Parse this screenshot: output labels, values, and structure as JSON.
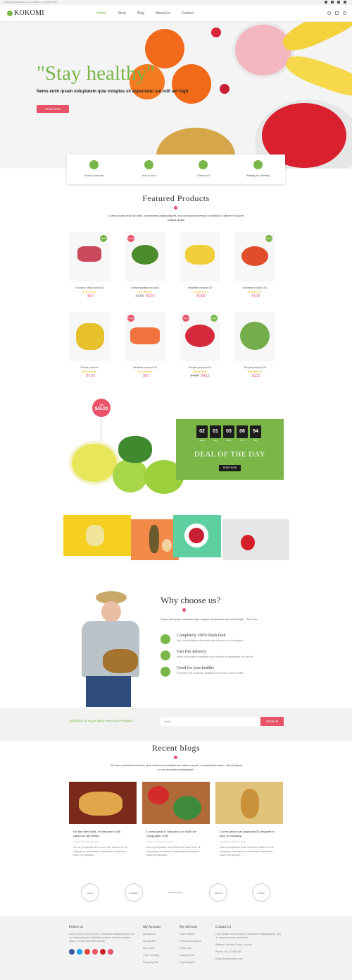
{
  "topbar": {
    "info": "Email: support@kokomi.com  |  Hotline: (+1) 234 567 890"
  },
  "header": {
    "logo": "KOKOMI",
    "nav": [
      "Home",
      "Shop",
      "Blog",
      "About Us",
      "Contact"
    ]
  },
  "hero": {
    "title": "\"Stay healthy\"",
    "subtitle": "Nemo enim ipsam voluptatem quia voluptas sit aspernatur aut odit aut fugit",
    "button": "SHOP NOW"
  },
  "steps": [
    "Select products",
    "Add to cart",
    "Check out",
    "Waiting for delivery"
  ],
  "featured": {
    "title": "Featured Products",
    "desc": "Lorem ipsum dolor sit amet, consectetur adipiscing elit, sed do eiusmod tempor incididunt ut labore et dolore magna aliqua",
    "products": [
      {
        "name": "Excuitur sllitur product",
        "stars": "★★★★★",
        "old": "",
        "price": "$60"
      },
      {
        "name": "Downloadable product",
        "stars": "★★★★★",
        "old": "$150",
        "price": "$120"
      },
      {
        "name": "Variable product 02",
        "stars": "★★★★★",
        "old": "",
        "price": "$150"
      },
      {
        "name": "Variable product 04",
        "stars": "★★★★★",
        "old": "",
        "price": "$130"
      },
      {
        "name": "Virtual product",
        "stars": "★★★★★",
        "old": "",
        "price": "$150"
      },
      {
        "name": "Variable product 01",
        "stars": "★★★★★",
        "old": "",
        "price": "$65"
      },
      {
        "name": "Simple product 02",
        "stars": "★★★★★",
        "old": "$455",
        "price": "$422"
      },
      {
        "name": "Simple product 03",
        "stars": "★★★★★",
        "old": "",
        "price": "$232"
      }
    ]
  },
  "deal": {
    "badge_only": "only",
    "badge_price": "$45.00",
    "digits": [
      "02",
      "01",
      "03",
      "06",
      "54"
    ],
    "digit_labels": [
      "Weeks",
      "Days",
      "Hours",
      "Mins",
      "Secs"
    ],
    "title": "DEAL OF THE DAY",
    "button": "SHOP NOW"
  },
  "why": {
    "title": "Why choose us?",
    "quote": "\"Nemo enim ipsam voluptatem quia voluptas sit aspernatur aut odit aut fugit.\" - John Doe",
    "items": [
      {
        "title": "Completely 100% fresh food",
        "desc": "Sed ut perspiciatis unde omnis iste natus error sit voluptatem"
      },
      {
        "title": "Fast free delivery",
        "desc": "Nemo enim ipsam voluptatem quia voluptas sit aspernatur aut odit aut"
      },
      {
        "title": "Good for your healthy",
        "desc": "Excepteur sint occaecat cupidatat non proident, sunt in culpa"
      }
    ]
  },
  "newsletter": {
    "text": "Subscribe us to get latest News and Products",
    "placeholder": "Email",
    "button": "SIGN IN"
  },
  "blogs": {
    "title": "Recent blogs",
    "desc": "\"Ut enim ad minima veniam, quis nostrum exercitationem ullam corporis suscipit laboriosam, nisi ut aliquid ex ea commodi consequatur\"",
    "posts": [
      {
        "title": "On the other hand, we denounce with righteous and dislike",
        "meta": "January 25, 2018 / by admin",
        "desc": "Sed ut perspiciatis unde omnis iste natus error sit voluptatem accusantium doloremque laudantium, totam rem aperiam."
      },
      {
        "title": "Lorem ipsum is ubiquitous to really the typographic style",
        "meta": "January 25, 2018 / by admin",
        "desc": "Sed ut perspiciatis unde omnis iste natus error sit voluptatem accusantium doloremque laudantium, totam rem aperiam."
      },
      {
        "title": "Lorem ipsum was purposefully designed to have no meaning",
        "meta": "January 25, 2018 / by admin",
        "desc": "Sed ut perspiciatis unde omnis iste natus error sit voluptatem accusantium doloremque laudantium, totam rem aperiam."
      }
    ]
  },
  "brands": [
    "Brand",
    "SWEDEN",
    "WOODSTOCK",
    "BRAND",
    "WINES"
  ],
  "footer": {
    "follow": {
      "title": "Follow us",
      "text": "Lorem ipsum dolor sit amet, consectetur adipisicing elit, sed do eiusmod tempor incididunt ut labore et dolore magna aliqua. Ut enim ad minim veniam."
    },
    "account": {
      "title": "My Account",
      "links": [
        "My Account",
        "My Wishlist",
        "My Orders",
        "Order Tracking",
        "Shopping Cart"
      ]
    },
    "services": {
      "title": "My Services",
      "links": [
        "Order History",
        "Returns/Exchanges",
        "Check Out",
        "Shipping Cart",
        "Login/Register"
      ]
    },
    "contact": {
      "title": "Contact Us",
      "text": "Lorem ipsum dolor sit amet, consectetur adipisicing elit, sed do eiusmod tempor incididunt.",
      "lines": [
        "Address: Nutfield Centre, London",
        "Phone: +01 23 456 789",
        "Email: info@kokomi.com"
      ]
    }
  },
  "colors": {
    "green": "#7ab648",
    "pink": "#e8536a"
  }
}
